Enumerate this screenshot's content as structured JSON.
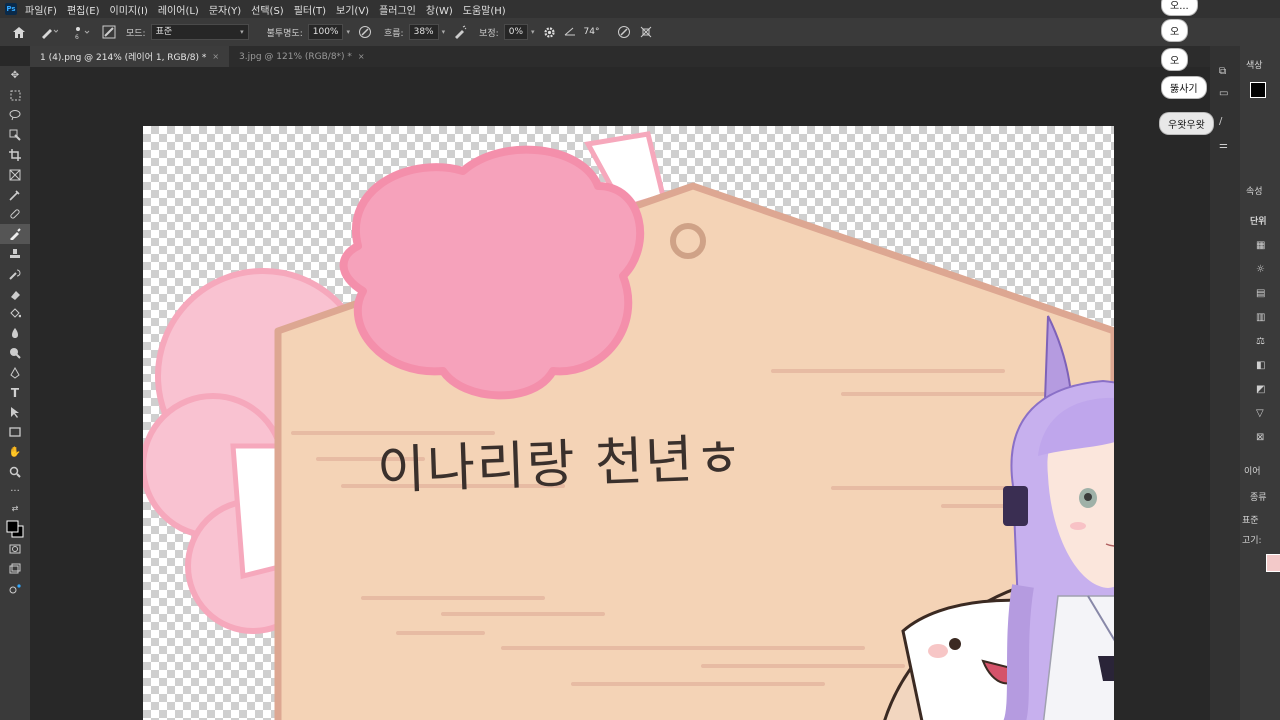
{
  "menubar": {
    "logo": "Ps",
    "items": [
      "파일(F)",
      "편집(E)",
      "이미지(I)",
      "레이어(L)",
      "문자(Y)",
      "선택(S)",
      "필터(T)",
      "보기(V)",
      "플러그인",
      "창(W)",
      "도움말(H)"
    ]
  },
  "options": {
    "mode_label": "모드:",
    "mode_value": "표준",
    "opacity_label": "불투명도:",
    "opacity_value": "100%",
    "flow_label": "흐름:",
    "flow_value": "38%",
    "smoothing_label": "보정:",
    "smoothing_value": "0%",
    "angle_value": "74°"
  },
  "tabs": [
    {
      "label": "1 (4).png @ 214% (레이어 1, RGB/8) *",
      "active": true
    },
    {
      "label": "3.jpg @ 121% (RGB/8*) *",
      "active": false
    }
  ],
  "canvas": {
    "text": "이나리랑 천년ㅎ"
  },
  "right_panel": {
    "color_label": "색상",
    "properties_label": "속성",
    "unit_label": "단위",
    "layers_label": "이어",
    "kind_label": "종류",
    "blend_label": "표준",
    "fill_label": "고기:"
  },
  "chat": {
    "bubbles": [
      "오...",
      "오",
      "오",
      "뚫사기",
      "우왓우왓"
    ]
  },
  "colors": {
    "menubar": "#323232",
    "options": "#3a3a3a",
    "canvas_bg": "#282828",
    "tag": "#f4d3b6",
    "pom": "#f6a2bb"
  }
}
